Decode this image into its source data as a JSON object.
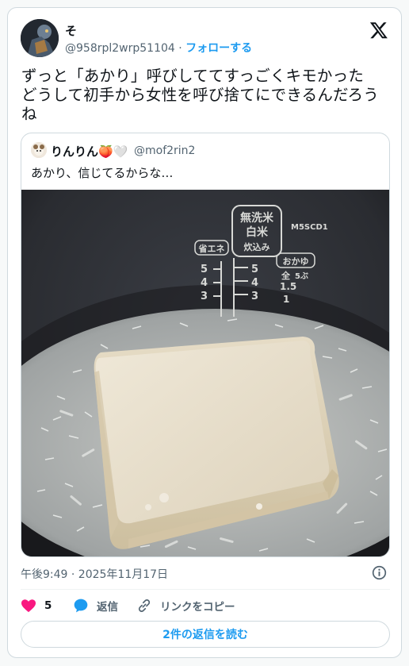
{
  "author": {
    "display_name": "そ",
    "handle": "@958rpl2wrp51104",
    "separator": " · ",
    "follow_label": "フォローする"
  },
  "tweet": {
    "text": "ずっと「あかり」呼びしててすっごくキモかった\nどうして初手から女性を呼び捨てにできるんだろう\nね"
  },
  "quote": {
    "display_name": "りんりん",
    "name_emoji": "🍑🤍",
    "handle": "@mof2rin2",
    "text": "あかり、信じてるからな…",
    "photo_label": "photo-tofu-in-rice-cooker",
    "cooker_labels": {
      "musenmai": "無洗米",
      "hakumai": "白米",
      "suikomi": "炊込み",
      "model": "M5SCD1",
      "shoene": "省エネ",
      "okayu": "おかゆ",
      "zen": "全",
      "gobu": "5ぶ"
    }
  },
  "meta": {
    "timestamp": "午後9:49 · 2025年11月17日"
  },
  "actions": {
    "like_count": "5",
    "reply_label": "返信",
    "copy_link_label": "リンクをコピー"
  },
  "read_replies_label": "2件の返信を読む",
  "colors": {
    "accent": "#1d9bf0",
    "like": "#f91880",
    "secondary_text": "#536471",
    "border": "#cfd9de"
  },
  "icons": [
    "x-logo-icon",
    "info-icon",
    "heart-icon",
    "reply-bubble-icon",
    "link-icon"
  ]
}
